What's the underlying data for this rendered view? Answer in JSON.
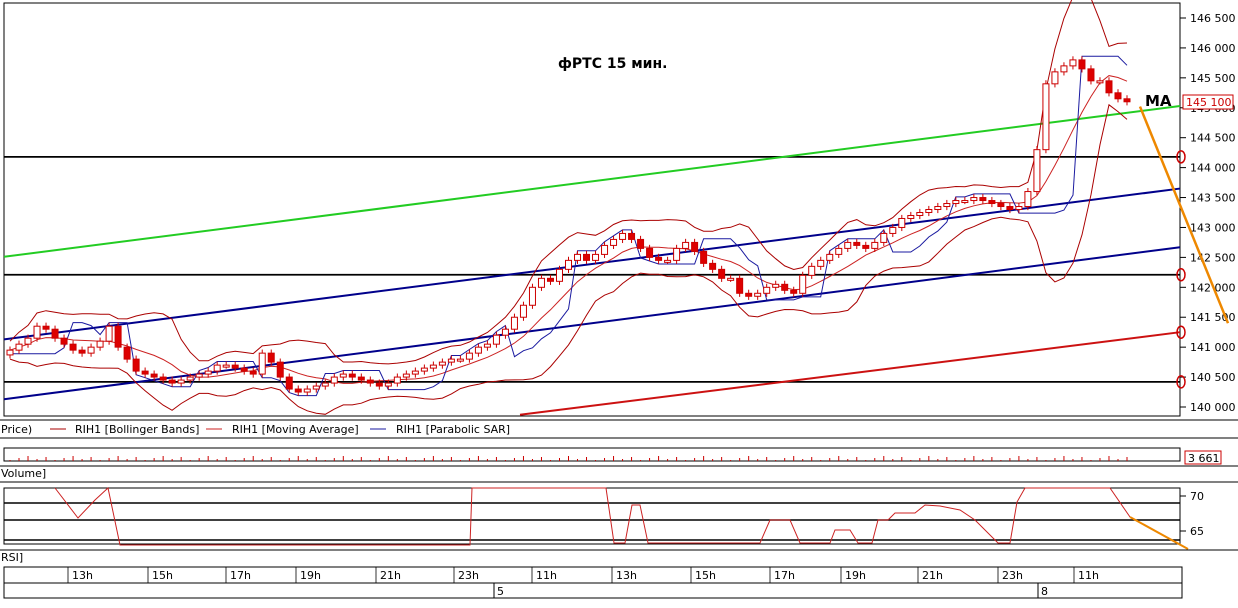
{
  "title": "фРТС   15 мин.",
  "ma_label": "MA",
  "colors": {
    "candle_up": "#cc0000",
    "candle_down": "#dd0000",
    "bollinger": "#aa0000",
    "moving_average": "#cc2222",
    "sar": "#1a1aa0",
    "green_channel": "#22cc22",
    "blue_channel": "#00008b",
    "red_channel": "#cc1111",
    "orange_arrow": "#ee8800",
    "level_line": "#000000",
    "price_box": "#cc0000"
  },
  "legend": {
    "price": "Price)",
    "bollinger": "RIH1 [Bollinger Bands]",
    "ma": "RIH1 [Moving Average]",
    "sar": "RIH1 [Parabolic SAR]"
  },
  "volume": {
    "label": "Volume]",
    "value": "3 661"
  },
  "rsi": {
    "label": "RSI]",
    "ticks": [
      "70",
      "65"
    ]
  },
  "price_box": "145 100",
  "y_ticks": [
    "146 500",
    "146 000",
    "145 500",
    "145 000",
    "144 500",
    "144 000",
    "143 500",
    "143 000",
    "142 500",
    "142 000",
    "141 500",
    "141 000",
    "140 500",
    "140 000"
  ],
  "x_hour_labels": [
    "13h",
    "15h",
    "17h",
    "19h",
    "21h",
    "23h",
    "11h",
    "13h",
    "15h",
    "17h",
    "19h",
    "21h",
    "23h",
    "11h"
  ],
  "day_labels": [
    "5",
    "8"
  ],
  "chart_data": {
    "type": "line",
    "title": "фРТС   15 мин.",
    "ylim": [
      139900,
      146600
    ],
    "y_ticks": [
      146500,
      146000,
      145500,
      145000,
      144500,
      144000,
      143500,
      143000,
      142500,
      142000,
      141500,
      141000,
      140500,
      140000
    ],
    "x_ticks": [
      "13h",
      "15h",
      "17h",
      "19h",
      "21h",
      "23h",
      "11h",
      "13h",
      "15h",
      "17h",
      "19h",
      "21h",
      "23h",
      "11h"
    ],
    "horizontal_levels": [
      144180,
      142210,
      140420
    ],
    "close_series": [
      140950,
      141050,
      141150,
      141350,
      141300,
      141150,
      141050,
      140950,
      140900,
      141000,
      141100,
      141350,
      141000,
      140800,
      140600,
      140550,
      140500,
      140450,
      140400,
      140450,
      140500,
      140550,
      140600,
      140700,
      140700,
      140650,
      140600,
      140550,
      140900,
      140750,
      140500,
      140300,
      140250,
      140300,
      140350,
      140400,
      140500,
      140550,
      140500,
      140450,
      140400,
      140350,
      140400,
      140500,
      140550,
      140600,
      140650,
      140700,
      140750,
      140800,
      140800,
      140900,
      141000,
      141050,
      141200,
      141300,
      141500,
      141700,
      142000,
      142150,
      142100,
      142300,
      142450,
      142550,
      142450,
      142550,
      142700,
      142800,
      142900,
      142800,
      142650,
      142500,
      142450,
      142450,
      142650,
      142750,
      142600,
      142400,
      142300,
      142150,
      142150,
      141900,
      141850,
      141900,
      142000,
      142050,
      141950,
      141900,
      142200,
      142350,
      142450,
      142550,
      142650,
      142750,
      142700,
      142650,
      142750,
      142900,
      143000,
      143150,
      143200,
      143250,
      143300,
      143350,
      143400,
      143450,
      143450,
      143500,
      143450,
      143400,
      143350,
      143300,
      143350,
      143600,
      144300,
      145400,
      145600,
      145700,
      145800,
      145650,
      145450,
      145450,
      145250,
      145150,
      145100
    ]
  }
}
